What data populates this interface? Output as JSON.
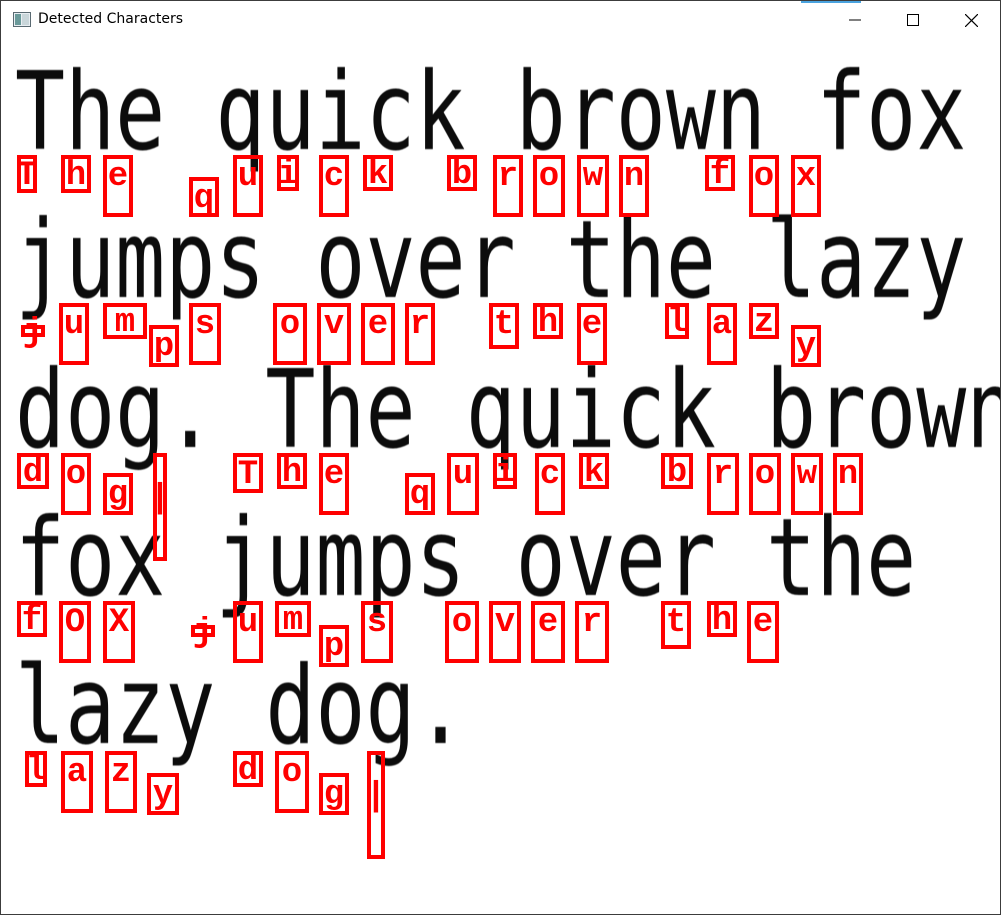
{
  "window": {
    "title": "Detected Characters",
    "icon": "app-window-icon",
    "controls": [
      {
        "name": "minimize-button",
        "icon": "minimize-icon"
      },
      {
        "name": "maximize-button",
        "icon": "maximize-icon"
      },
      {
        "name": "close-button",
        "icon": "close-icon"
      }
    ]
  },
  "image_text": {
    "lines": [
      "The quick brown fox",
      "jumps over the lazy",
      "dog. The quick brown",
      "fox jumps over the",
      "lazy dog."
    ]
  },
  "colors": {
    "box": "#ff0000",
    "label": "#ff0000",
    "text": "#0c0c0c"
  },
  "detections": [
    {
      "label": "T"
    },
    {
      "label": "h"
    },
    {
      "label": "e"
    },
    {
      "label": "q"
    },
    {
      "label": "u"
    },
    {
      "label": "i"
    },
    {
      "label": "c"
    },
    {
      "label": "k"
    },
    {
      "label": "b"
    },
    {
      "label": "r"
    },
    {
      "label": "o"
    },
    {
      "label": "w"
    },
    {
      "label": "n"
    },
    {
      "label": "f"
    },
    {
      "label": "o"
    },
    {
      "label": "x"
    },
    {
      "label": "j"
    },
    {
      "label": "u"
    },
    {
      "label": "m"
    },
    {
      "label": "p"
    },
    {
      "label": "s"
    },
    {
      "label": "o"
    },
    {
      "label": "v"
    },
    {
      "label": "e"
    },
    {
      "label": "r"
    },
    {
      "label": "t"
    },
    {
      "label": "h"
    },
    {
      "label": "e"
    },
    {
      "label": "l"
    },
    {
      "label": "a"
    },
    {
      "label": "z"
    },
    {
      "label": "y"
    },
    {
      "label": "d"
    },
    {
      "label": "o"
    },
    {
      "label": "g"
    },
    {
      "label": "|"
    },
    {
      "label": "T"
    },
    {
      "label": "h"
    },
    {
      "label": "e"
    },
    {
      "label": "q"
    },
    {
      "label": "u"
    },
    {
      "label": "i"
    },
    {
      "label": "c"
    },
    {
      "label": "k"
    },
    {
      "label": "b"
    },
    {
      "label": "r"
    },
    {
      "label": "o"
    },
    {
      "label": "w"
    },
    {
      "label": "n"
    },
    {
      "label": "f"
    },
    {
      "label": "O"
    },
    {
      "label": "X"
    },
    {
      "label": "j"
    },
    {
      "label": "u"
    },
    {
      "label": "m"
    },
    {
      "label": "p"
    },
    {
      "label": "s"
    },
    {
      "label": "o"
    },
    {
      "label": "v"
    },
    {
      "label": "e"
    },
    {
      "label": "r"
    },
    {
      "label": "t"
    },
    {
      "label": "h"
    },
    {
      "label": "e"
    },
    {
      "label": "l"
    },
    {
      "label": "a"
    },
    {
      "label": "z"
    },
    {
      "label": "y"
    },
    {
      "label": "d"
    },
    {
      "label": "o"
    },
    {
      "label": "g"
    },
    {
      "label": "|"
    }
  ]
}
